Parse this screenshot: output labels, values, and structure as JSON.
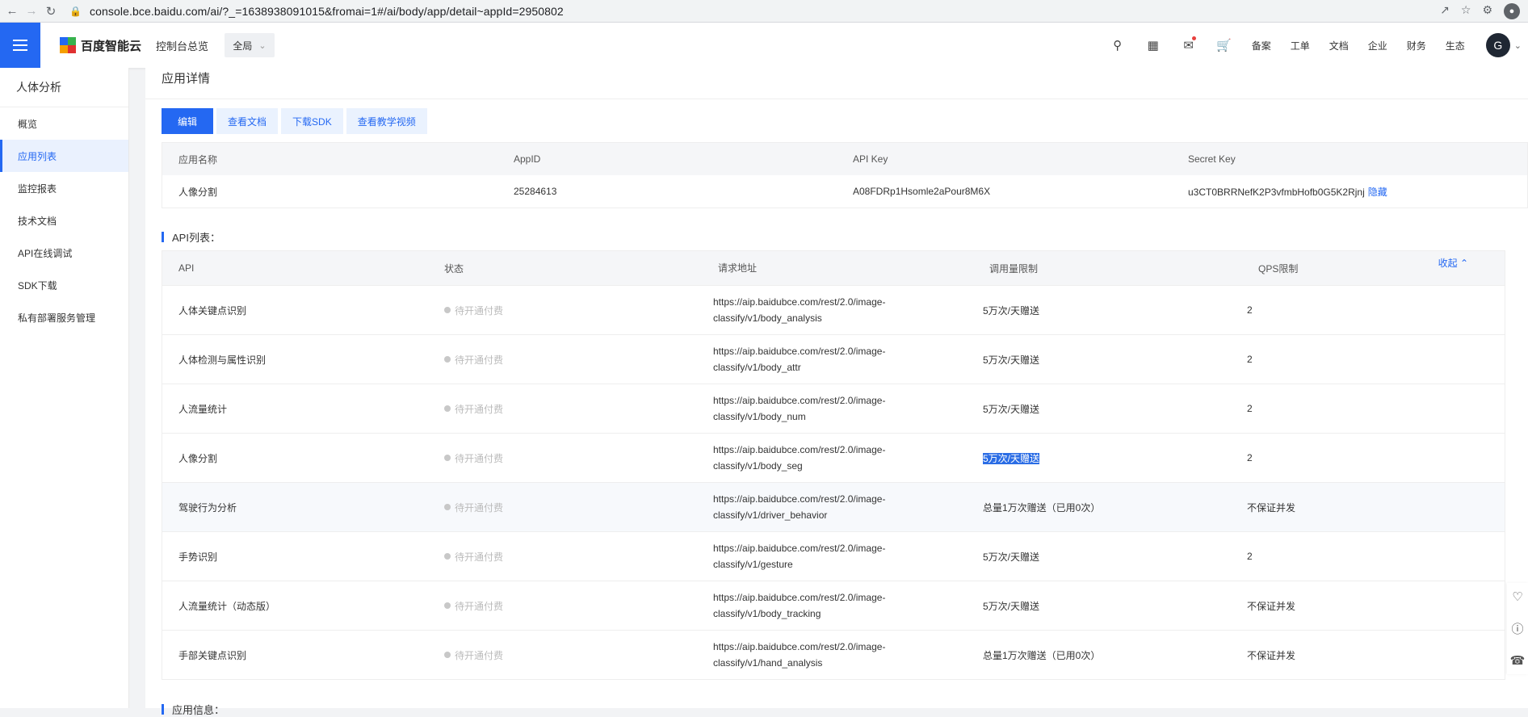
{
  "browser": {
    "url": "console.bce.baidu.com/ai/?_=1638938091015&fromai=1#/ai/body/app/detail~appId=2950802",
    "profile_initial": ""
  },
  "topnav": {
    "logo_text": "百度智能云",
    "console_link": "控制台总览",
    "scope_label": "全局",
    "links": [
      "备案",
      "工单",
      "文档",
      "企业",
      "财务",
      "生态"
    ],
    "user_initial": "G"
  },
  "sidebar": {
    "title": "人体分析",
    "items": [
      "概览",
      "应用列表",
      "监控报表",
      "技术文档",
      "API在线调试",
      "SDK下载",
      "私有部署服务管理"
    ],
    "active_index": 1
  },
  "main": {
    "page_title": "应用详情",
    "buttons": {
      "edit": "编辑",
      "docs": "查看文档",
      "sdk": "下载SDK",
      "video": "查看教学视频"
    },
    "app_info": {
      "headers": [
        "应用名称",
        "AppID",
        "API Key",
        "Secret Key"
      ],
      "values": [
        "人像分割",
        "25284613",
        "A08FDRp1Hsomle2aPour8M6X",
        "u3CT0BRRNefK2P3vfmbHofb0G5K2Rjnj"
      ],
      "hide_link": "隐藏"
    },
    "api_section_title": "API列表：",
    "api_table": {
      "headers": [
        "API",
        "状态",
        "请求地址",
        "调用量限制",
        "QPS限制"
      ],
      "collapse_label": "收起",
      "rows": [
        {
          "name": "人体关键点识别",
          "status": "待开通付费",
          "url1": "https://aip.baidubce.com/rest/2.0/image-",
          "url2": "classify/v1/body_analysis",
          "limit": "5万次/天赠送",
          "qps": "2"
        },
        {
          "name": "人体检测与属性识别",
          "status": "待开通付费",
          "url1": "https://aip.baidubce.com/rest/2.0/image-",
          "url2": "classify/v1/body_attr",
          "limit": "5万次/天赠送",
          "qps": "2"
        },
        {
          "name": "人流量统计",
          "status": "待开通付费",
          "url1": "https://aip.baidubce.com/rest/2.0/image-",
          "url2": "classify/v1/body_num",
          "limit": "5万次/天赠送",
          "qps": "2"
        },
        {
          "name": "人像分割",
          "status": "待开通付费",
          "url1": "https://aip.baidubce.com/rest/2.0/image-",
          "url2": "classify/v1/body_seg",
          "limit": "5万次/天赠送",
          "qps": "2"
        },
        {
          "name": "驾驶行为分析",
          "status": "待开通付费",
          "url1": "https://aip.baidubce.com/rest/2.0/image-",
          "url2": "classify/v1/driver_behavior",
          "limit": "总量1万次赠送（已用0次）",
          "qps": "不保证并发"
        },
        {
          "name": "手势识别",
          "status": "待开通付费",
          "url1": "https://aip.baidubce.com/rest/2.0/image-",
          "url2": "classify/v1/gesture",
          "limit": "5万次/天赠送",
          "qps": "2"
        },
        {
          "name": "人流量统计（动态版）",
          "status": "待开通付费",
          "url1": "https://aip.baidubce.com/rest/2.0/image-",
          "url2": "classify/v1/body_tracking",
          "limit": "5万次/天赠送",
          "qps": "不保证并发"
        },
        {
          "name": "手部关键点识别",
          "status": "待开通付费",
          "url1": "https://aip.baidubce.com/rest/2.0/image-",
          "url2": "classify/v1/hand_analysis",
          "limit": "总量1万次赠送（已用0次）",
          "qps": "不保证并发"
        }
      ]
    },
    "bottom_section_title": "应用信息："
  },
  "colors": {
    "accent": "#2468f2",
    "selection": "#2b6de5"
  }
}
